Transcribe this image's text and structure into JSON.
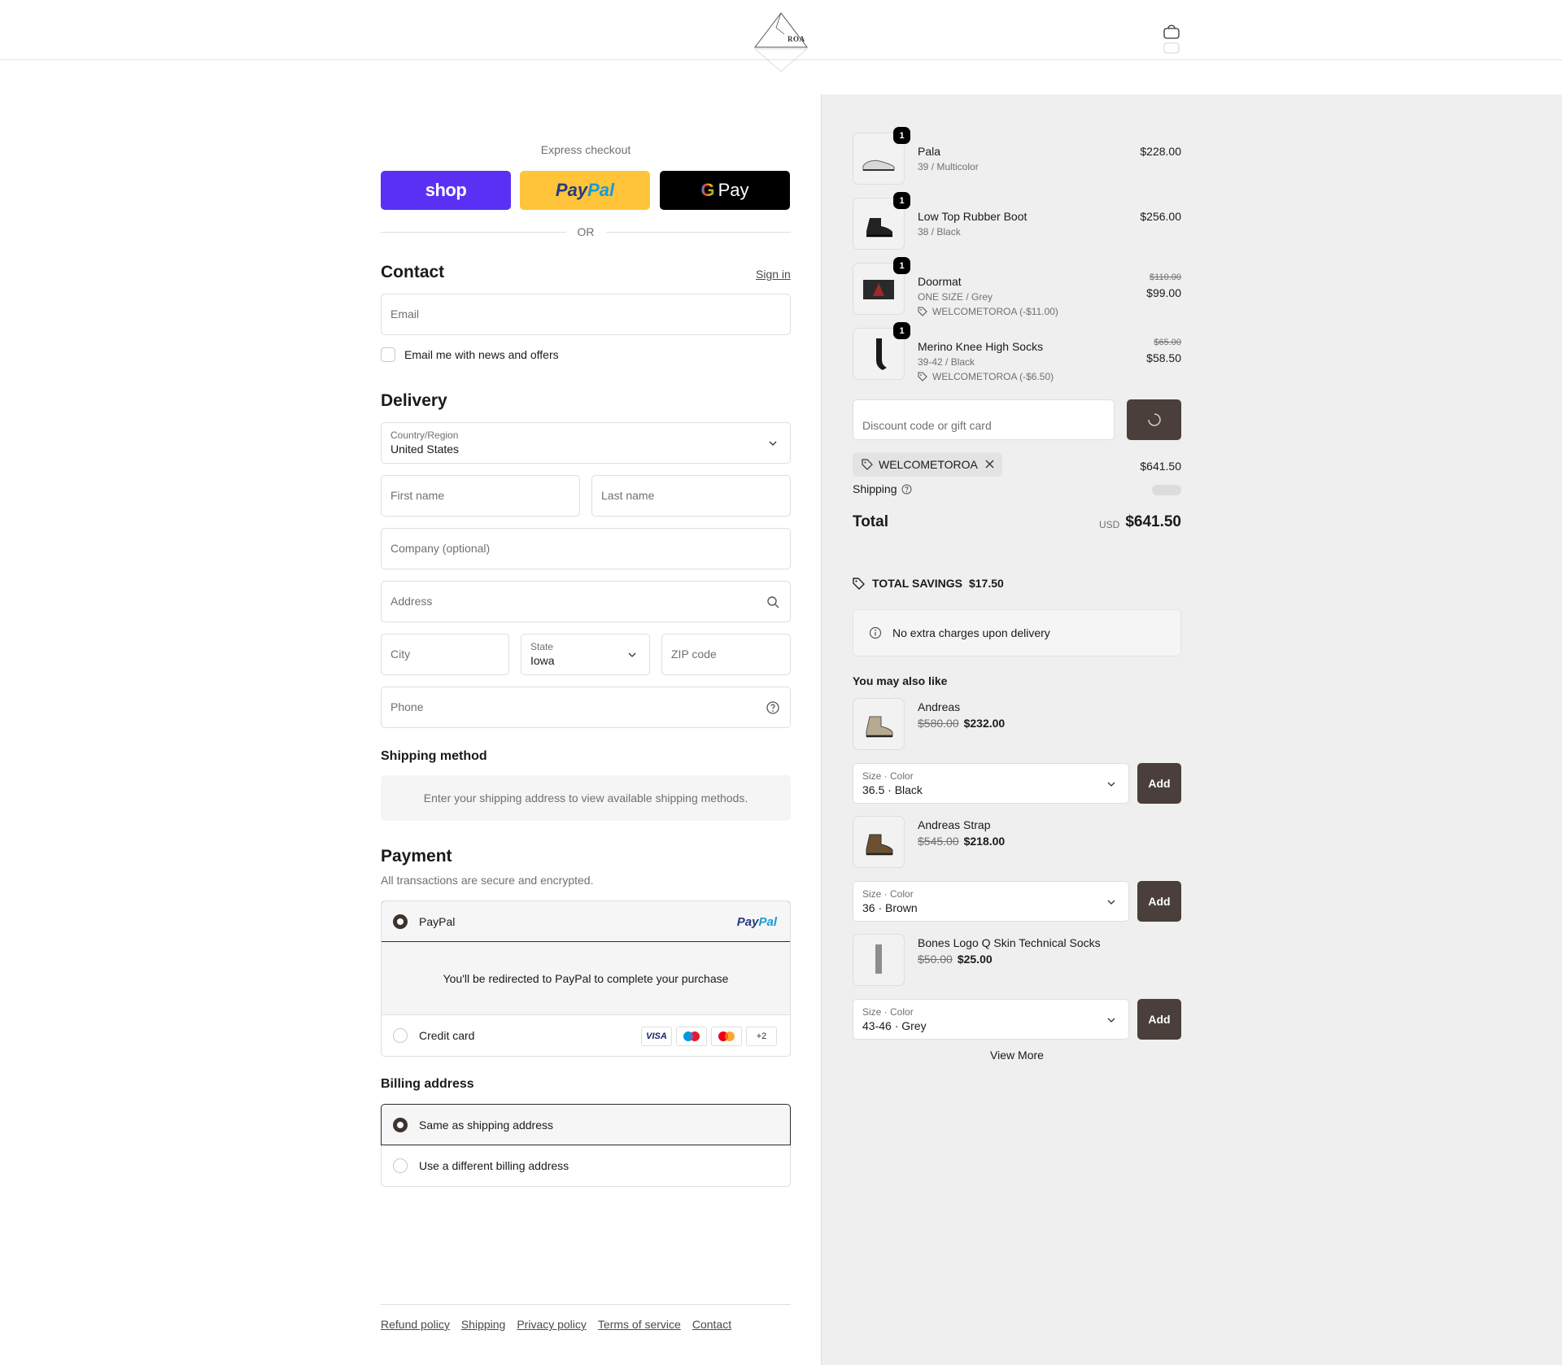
{
  "header": {
    "logo_text": "ROA"
  },
  "express": {
    "label": "Express checkout",
    "shop_label": "shop",
    "paypal_a": "Pay",
    "paypal_b": "Pal",
    "gpay_g": "G",
    "gpay_label": "Pay",
    "or_label": "OR"
  },
  "contact": {
    "title": "Contact",
    "sign_in": "Sign in",
    "email_placeholder": "Email",
    "news_label": "Email me with news and offers"
  },
  "delivery": {
    "title": "Delivery",
    "country_label": "Country/Region",
    "country_value": "United States",
    "first_name": "First name",
    "last_name": "Last name",
    "company": "Company (optional)",
    "address": "Address",
    "city": "City",
    "state_label": "State",
    "state_value": "Iowa",
    "zip": "ZIP code",
    "phone": "Phone"
  },
  "shipping_method": {
    "title": "Shipping method",
    "note": "Enter your shipping address to view available shipping methods."
  },
  "payment": {
    "title": "Payment",
    "subtitle": "All transactions are secure and encrypted.",
    "paypal_label": "PayPal",
    "paypal_logo_a": "Pay",
    "paypal_logo_b": "Pal",
    "redirect_text": "You'll be redirected to PayPal to complete your purchase",
    "credit_label": "Credit card",
    "cards": [
      "VISA",
      "+2"
    ]
  },
  "billing": {
    "title": "Billing address",
    "same": "Same as shipping address",
    "different": "Use a different billing address"
  },
  "footer": {
    "links": [
      "Refund policy",
      "Shipping",
      "Privacy policy",
      "Terms of service",
      "Contact"
    ]
  },
  "cart": {
    "items": [
      {
        "qty": "1",
        "name": "Pala",
        "variant": "39 / Multicolor",
        "price": "$228.00"
      },
      {
        "qty": "1",
        "name": "Low Top Rubber Boot",
        "variant": "38 / Black",
        "price": "$256.00"
      },
      {
        "qty": "1",
        "name": "Doormat",
        "variant": "ONE SIZE / Grey",
        "discount": "WELCOMETOROA (-$11.00)",
        "old_price": "$110.00",
        "price": "$99.00"
      },
      {
        "qty": "1",
        "name": "Merino Knee High Socks",
        "variant": "39-42 / Black",
        "discount": "WELCOMETOROA (-$6.50)",
        "old_price": "$65.00",
        "price": "$58.50"
      }
    ],
    "discount_placeholder": "Discount code or gift card",
    "applied_code": "WELCOMETOROA",
    "subtotal": "$641.50",
    "shipping_label": "Shipping",
    "total_label": "Total",
    "currency": "USD",
    "total": "$641.50",
    "savings_label": "TOTAL SAVINGS",
    "savings_value": "$17.50",
    "notice": "No extra charges upon delivery"
  },
  "recommendations": {
    "title": "You may also like",
    "select_label": "Size · Color",
    "add_label": "Add",
    "view_more": "View More",
    "items": [
      {
        "name": "Andreas",
        "old_price": "$580.00",
        "price": "$232.00",
        "option": "36.5 · Black"
      },
      {
        "name": "Andreas Strap",
        "old_price": "$545.00",
        "price": "$218.00",
        "option": "36 · Brown"
      },
      {
        "name": "Bones Logo Q Skin Technical Socks",
        "old_price": "$50.00",
        "price": "$25.00",
        "option": "43-46 · Grey"
      }
    ]
  },
  "colors": {
    "accent": "#4a3f3a",
    "shop": "#5a31f4",
    "paypal": "#ffc439",
    "summary_bg": "#efefef"
  }
}
